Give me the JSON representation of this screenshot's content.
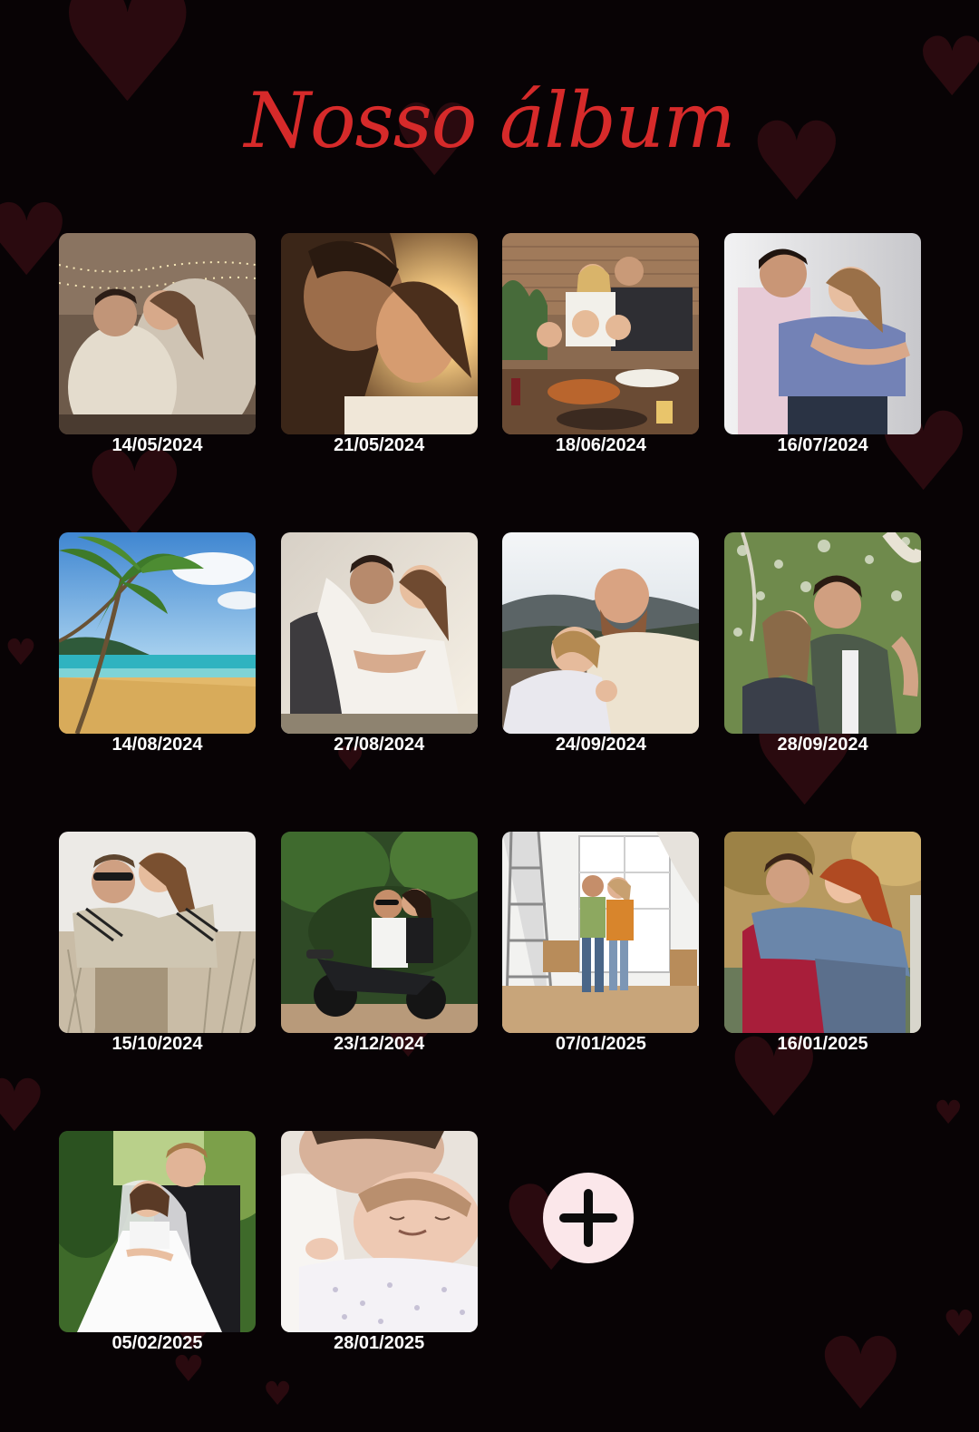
{
  "album": {
    "title": "Nosso álbum"
  },
  "photos": [
    {
      "date": "14/05/2024",
      "scene": "couple-kiss-fairy-lights"
    },
    {
      "date": "21/05/2024",
      "scene": "couple-sunset-kiss"
    },
    {
      "date": "18/06/2024",
      "scene": "family-dinner-table"
    },
    {
      "date": "16/07/2024",
      "scene": "couple-embrace-studio"
    },
    {
      "date": "14/08/2024",
      "scene": "beach-palm-trees"
    },
    {
      "date": "27/08/2024",
      "scene": "couple-hug-bright"
    },
    {
      "date": "24/09/2024",
      "scene": "couple-mountain-selfie"
    },
    {
      "date": "28/09/2024",
      "scene": "couple-hiking-selfie"
    },
    {
      "date": "15/10/2024",
      "scene": "couple-field-piggyback"
    },
    {
      "date": "23/12/2024",
      "scene": "couple-motorcycle"
    },
    {
      "date": "07/01/2025",
      "scene": "couple-new-home"
    },
    {
      "date": "16/01/2025",
      "scene": "couple-autumn-hug"
    },
    {
      "date": "05/02/2025",
      "scene": "wedding-couple"
    },
    {
      "date": "28/01/2025",
      "scene": "parent-with-baby"
    }
  ],
  "add_button": {
    "icon": "plus-icon"
  },
  "colors": {
    "background": "#080305",
    "title": "#d62a2a",
    "date_text": "#ffffff",
    "add_button_bg": "#fbe7ea",
    "heart": "#2a0a0f"
  }
}
